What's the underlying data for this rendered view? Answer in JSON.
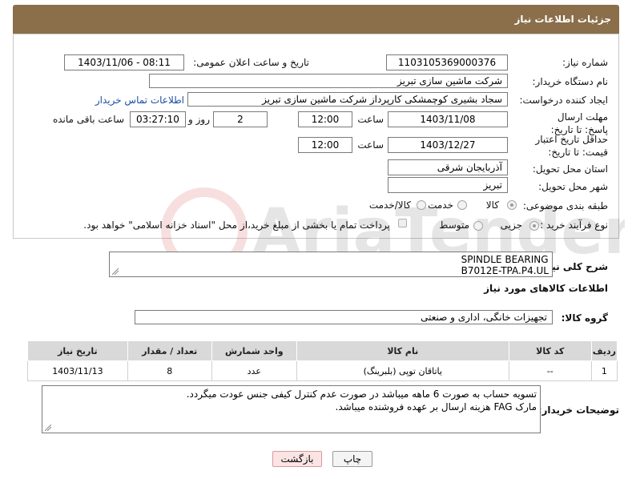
{
  "header": {
    "title": "جزئیات اطلاعات نیاز"
  },
  "form": {
    "need_number_label": "شماره نیاز:",
    "need_number": "1103105369000376",
    "announce_label": "تاریخ و ساعت اعلان عمومی:",
    "announce_value": "1403/11/06 - 08:11",
    "buyer_org_label": "نام دستگاه خریدار:",
    "buyer_org": "شرکت ماشین سازی تبریز",
    "creator_label": "ایجاد کننده درخواست:",
    "creator": "سجاد بشیری کوچمشکی کارپرداز شرکت ماشین سازی تبریز",
    "contact_link": "اطلاعات تماس خریدار",
    "reply_deadline_label": "مهلت ارسال پاسخ: تا تاریخ:",
    "reply_date": "1403/11/08",
    "time_label": "ساعت",
    "reply_time": "12:00",
    "days_value": "2",
    "days_label": "روز و",
    "remaining_time": "03:27:10",
    "remaining_label": "ساعت باقی مانده",
    "price_validity_label": "حداقل تاریخ اعتبار قیمت: تا تاریخ:",
    "price_date": "1403/12/27",
    "price_time": "12:00",
    "province_label": "استان محل تحویل:",
    "province": "آذربایجان شرقی",
    "city_label": "شهر محل تحویل:",
    "city": "تبریز",
    "category_label": "طبقه بندی موضوعی:",
    "category_options": [
      "کالا",
      "خدمت",
      "کالا/خدمت"
    ],
    "process_label": "نوع فرآیند خرید :",
    "process_options": [
      "جزیی",
      "متوسط"
    ],
    "payment_note": "پرداخت تمام یا بخشی از مبلغ خرید،از محل \"اسناد خزانه اسلامی\" خواهد بود."
  },
  "summary": {
    "label": "شرح کلی نیاز:",
    "line1": "SPINDLE BEARING",
    "line2": "B7012E-TPA.P4.UL"
  },
  "goods_info": {
    "title": "اطلاعات کالاهای مورد نیاز",
    "group_label": "گروه کالا:",
    "group_value": "تجهیزات خانگی، اداری و صنعتی"
  },
  "table": {
    "headers": [
      "ردیف",
      "کد کالا",
      "نام کالا",
      "واحد شمارش",
      "تعداد / مقدار",
      "تاریخ نیاز"
    ],
    "rows": [
      {
        "row": "1",
        "code": "--",
        "name": "یاتاقان توپی (بلبرینگ)",
        "unit": "عدد",
        "qty": "8",
        "date": "1403/11/13"
      }
    ]
  },
  "buyer_notes": {
    "label": "توضیحات خریدار:",
    "line1": "تسویه حساب به صورت 6 ماهه میباشد در صورت عدم کنترل کیفی جنس عودت میگردد.",
    "line2": "مارک FAG هزینه ارسال بر عهده فروشنده میباشد."
  },
  "buttons": {
    "print": "چاپ",
    "back": "بازگشت"
  },
  "watermark": {
    "text": "AriaTender.net"
  }
}
